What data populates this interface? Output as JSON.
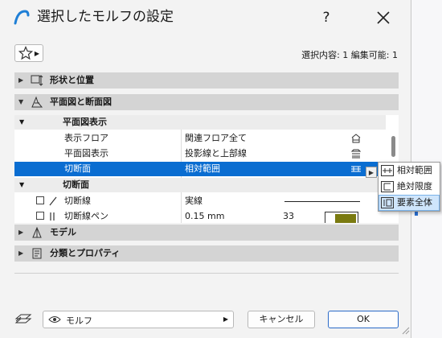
{
  "window": {
    "title": "選択したモルフの設定",
    "help": "?",
    "close": "✕"
  },
  "toolbar": {
    "selection_info": "選択内容: 1 編集可能: 1"
  },
  "panels": {
    "shape": "形状と位置",
    "plan": "平面図と断面図",
    "model": "モデル",
    "classification": "分類とプロパティ"
  },
  "table": {
    "group1": "平面図表示",
    "rows": [
      {
        "name": "表示フロア",
        "value": "関連フロア全て"
      },
      {
        "name": "平面図表示",
        "value": "投影線と上部線"
      },
      {
        "name": "切断面",
        "value": "相対範囲"
      }
    ],
    "group2": "切断面",
    "rows2": [
      {
        "name": "切断線",
        "value": "実線"
      },
      {
        "name": "切断線ペン",
        "value": "0.15 mm",
        "extra": "33"
      }
    ]
  },
  "popup": {
    "items": [
      "相対範囲",
      "絶対限度",
      "要素全体"
    ],
    "highlighted_index": 2
  },
  "footer": {
    "layer": "モルフ",
    "cancel": "キャンセル",
    "ok": "OK"
  },
  "colors": {
    "selection": "#0a6dd1",
    "accent": "#2a6ac8",
    "pen_swatch": "#7a7a10"
  }
}
